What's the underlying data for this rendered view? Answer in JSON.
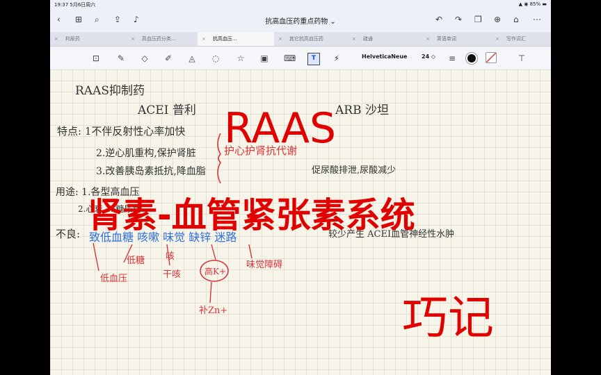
{
  "status_bar": {
    "time_date": "19:37  5月6日周六",
    "battery": "85%"
  },
  "nav": {
    "title": "抗高血压药重点药物 ⌄"
  },
  "tabs": [
    {
      "label": "利尿药"
    },
    {
      "label": "高血压药分类..."
    },
    {
      "label": "抗高血压..."
    },
    {
      "label": "其它抗高血压药"
    },
    {
      "label": "疏通"
    },
    {
      "label": "英语单词"
    },
    {
      "label": "写作词汇"
    }
  ],
  "toolbar": {
    "font_name": "HelveticaNeue",
    "font_size": "24 ◇",
    "text_tool_label": "T"
  },
  "note": {
    "heading": "RAAS抑制药",
    "acei": "ACEI  普利",
    "arb": "ARB  沙坦",
    "feature_1": "特点: 1不伴反射性心率加快",
    "feature_2": "2.逆心肌重构,保护肾脏",
    "feature_3": "3.改善胰岛素抵抗,降血脂",
    "brace_note": "护心护肾抗代谢",
    "arb_note": "促尿酸排泄,尿酸减少",
    "use_line": "用途: 1.各型高血压",
    "use_line_2": "2.心衰 ...  糖尿病...",
    "adverse_label": "不良:",
    "adverse_blue": "致低血糖 咳嗽 味觉 缺锌 迷路",
    "adverse_right": "较少产生 ACEI血管神经性水肿",
    "red_lowsugar": "低糖",
    "red_cough": "咳",
    "red_dry_cough": "干咳",
    "red_lowbp": "低血压",
    "red_circle": "高K+",
    "red_taste": "味觉障碍",
    "red_zinc": "补Zn+"
  },
  "overlay": {
    "raas": "RAAS",
    "system": "肾素-血管紧张素系统",
    "tip": "巧记"
  }
}
